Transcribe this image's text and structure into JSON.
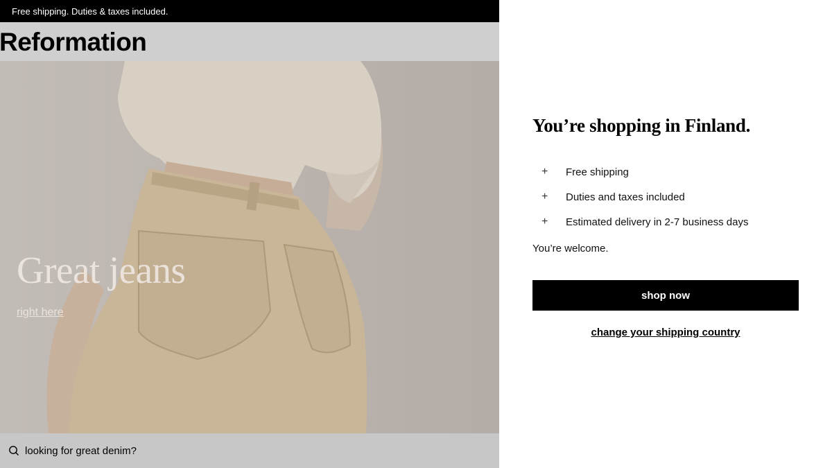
{
  "announcement": "Free shipping. Duties & taxes included.",
  "brand": "Reformation",
  "hero": {
    "title": "Great jeans",
    "link": "right here"
  },
  "search": {
    "icon": "search-icon",
    "placeholder": "looking for great denim?"
  },
  "modal": {
    "title": "You’re shopping in Finland.",
    "benefits": [
      {
        "icon": "plus",
        "label": "Free shipping"
      },
      {
        "icon": "plus",
        "label": "Duties and taxes included"
      },
      {
        "icon": "plus",
        "label": "Estimated delivery in 2-7 business days"
      }
    ],
    "welcome": "You’re welcome.",
    "shop_now": "shop now",
    "change_country": "change your shipping country"
  },
  "colors": {
    "button_bg": "#000000",
    "overlay": "#cfcfcf"
  }
}
